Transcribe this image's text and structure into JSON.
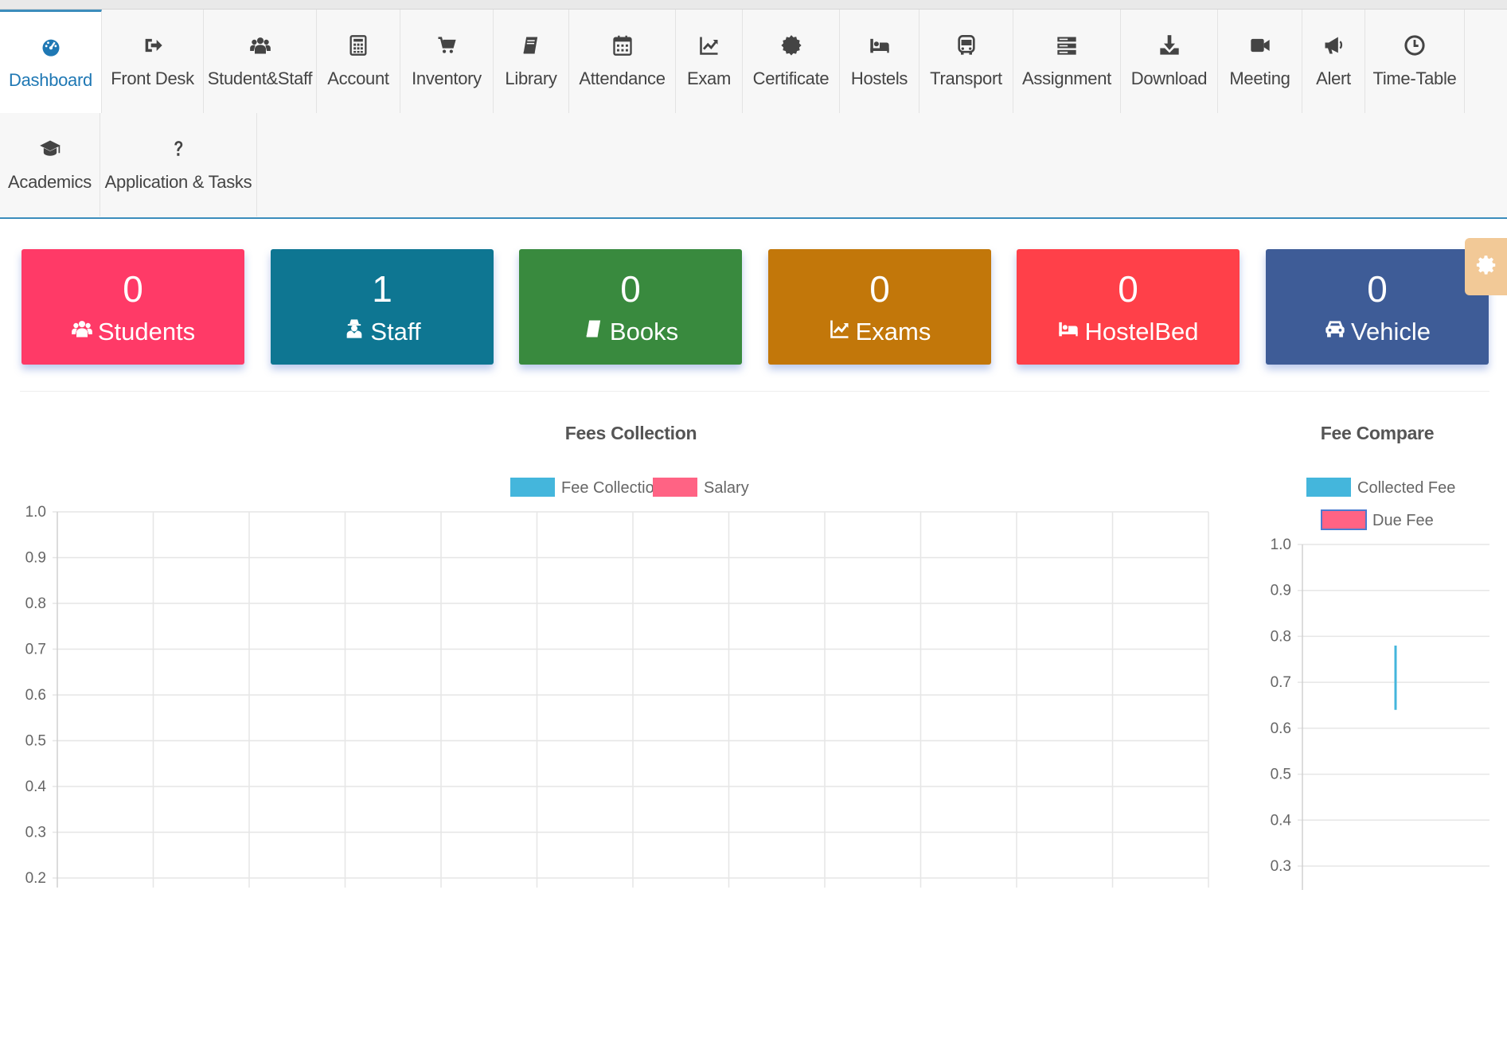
{
  "nav": {
    "row1": [
      {
        "label": "Dashboard",
        "icon": "dashboard-icon",
        "active": true
      },
      {
        "label": "Front Desk",
        "icon": "sign-out-icon"
      },
      {
        "label": "Student&Staff",
        "icon": "users-icon"
      },
      {
        "label": "Account",
        "icon": "calculator-icon"
      },
      {
        "label": "Inventory",
        "icon": "cart-icon"
      },
      {
        "label": "Library",
        "icon": "book-icon"
      },
      {
        "label": "Attendance",
        "icon": "calendar-icon"
      },
      {
        "label": "Exam",
        "icon": "line-chart-icon"
      },
      {
        "label": "Certificate",
        "icon": "certificate-icon"
      },
      {
        "label": "Hostels",
        "icon": "bed-icon"
      },
      {
        "label": "Transport",
        "icon": "bus-icon"
      },
      {
        "label": "Assignment",
        "icon": "server-icon"
      },
      {
        "label": "Download",
        "icon": "download-icon"
      },
      {
        "label": "Meeting",
        "icon": "video-icon"
      },
      {
        "label": "Alert",
        "icon": "bullhorn-icon"
      },
      {
        "label": "Time-Table",
        "icon": "clock-icon"
      }
    ],
    "row2": [
      {
        "label": "Academics",
        "icon": "graduation-cap-icon"
      },
      {
        "label": "Application & Tasks",
        "icon": "question-icon"
      }
    ]
  },
  "cards": [
    {
      "value": "0",
      "label": "Students",
      "icon": "users-icon",
      "color": "#ff3a67"
    },
    {
      "value": "1",
      "label": "Staff",
      "icon": "user-secret-icon",
      "color": "#0e7692"
    },
    {
      "value": "0",
      "label": "Books",
      "icon": "book-icon",
      "color": "#398a3e"
    },
    {
      "value": "0",
      "label": "Exams",
      "icon": "line-chart-icon",
      "color": "#c2770a"
    },
    {
      "value": "0",
      "label": "HostelBed",
      "icon": "bed-icon",
      "color": "#ff4049"
    },
    {
      "value": "0",
      "label": "Vehicle",
      "icon": "car-icon",
      "color": "#3e5c97"
    }
  ],
  "settings_icon": "gear-icon",
  "chart_data": [
    {
      "type": "bar",
      "title": "Fees Collection",
      "series": [
        {
          "name": "Fee Collection",
          "color": "#44b6dc",
          "values": []
        },
        {
          "name": "Salary",
          "color": "#ff6384",
          "values": []
        }
      ],
      "categories": [],
      "y_ticks": [
        "1.0",
        "0.9",
        "0.8",
        "0.7",
        "0.6",
        "0.5",
        "0.4",
        "0.3",
        "0.2"
      ],
      "ylim": [
        0.2,
        1.0
      ],
      "grid": true,
      "legend": "top"
    },
    {
      "type": "bar",
      "title": "Fee Compare",
      "series": [
        {
          "name": "Collected Fee",
          "color": "#44b6dc",
          "values": [
            0.78
          ]
        },
        {
          "name": "Due Fee",
          "color": "#ff6384",
          "values": []
        }
      ],
      "y_ticks": [
        "1.0",
        "0.9",
        "0.8",
        "0.7",
        "0.6",
        "0.5",
        "0.4",
        "0.3"
      ],
      "ylim": [
        0.3,
        1.0
      ],
      "grid": true,
      "legend": "top"
    }
  ]
}
